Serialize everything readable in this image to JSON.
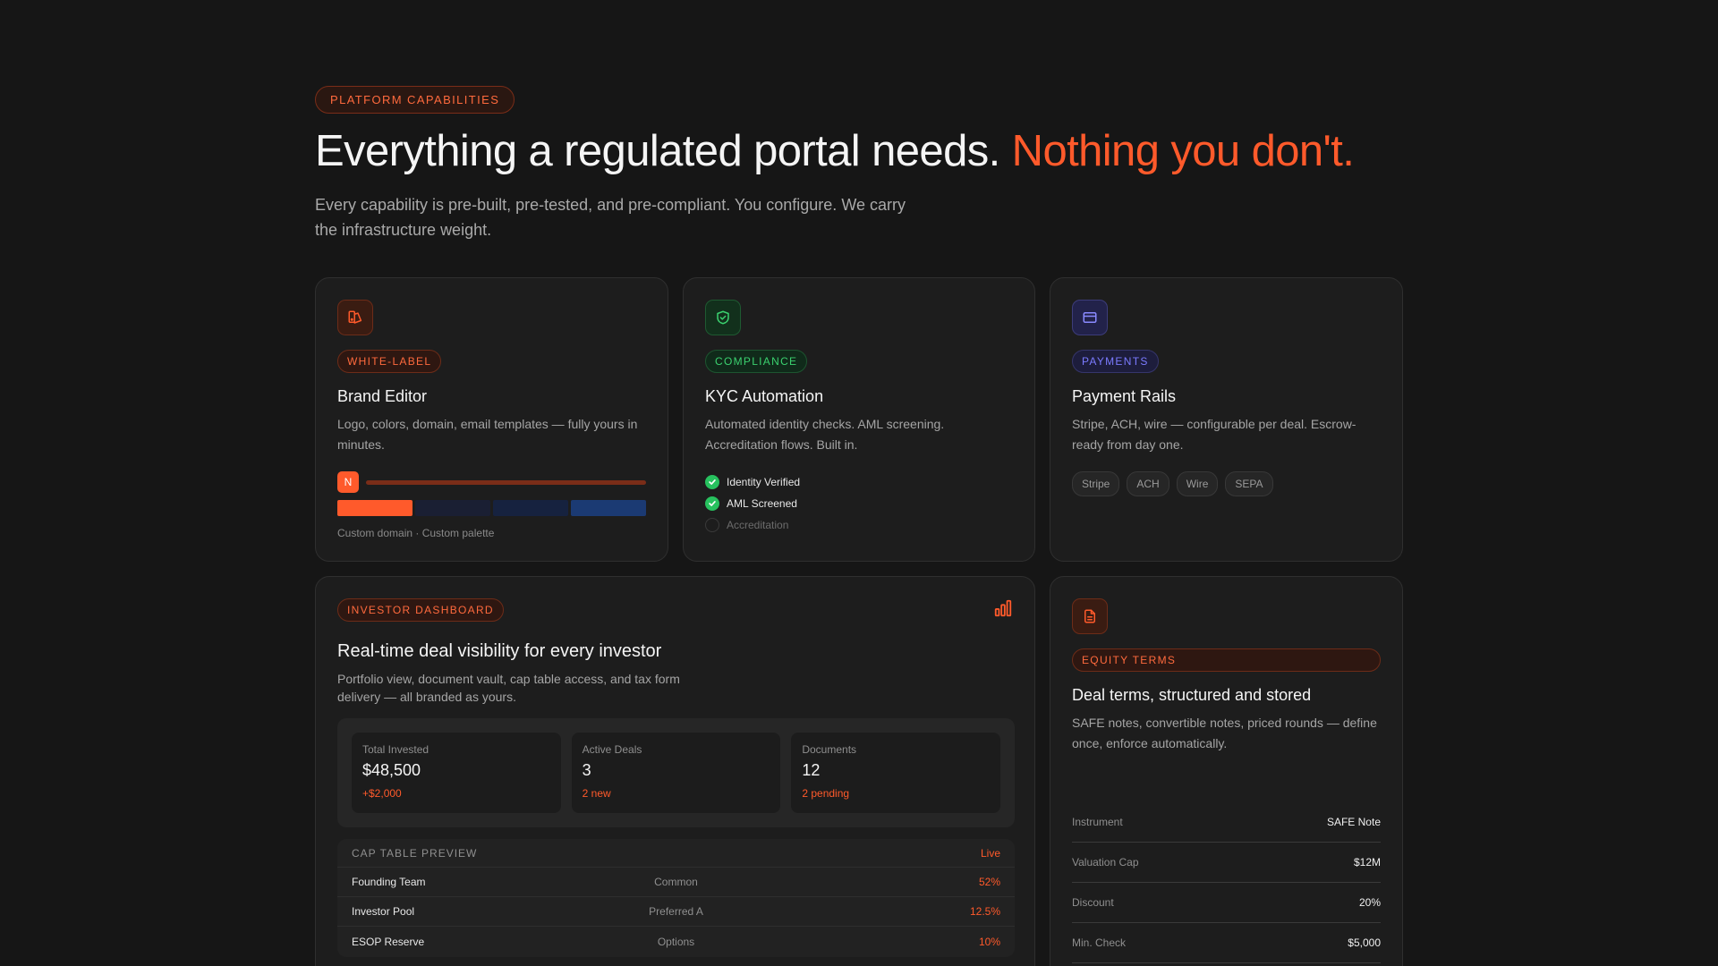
{
  "header": {
    "eyebrow": "PLATFORM CAPABILITIES",
    "headline_main": "Everything a regulated portal needs.",
    "headline_accent": "Nothing you don't.",
    "subhead": "Every capability is pre-built, pre-tested, and pre-compliant. You configure. We carry the infrastructure weight."
  },
  "colors": {
    "background": "#161616",
    "accent_orange": "#ff5a2b",
    "accent_green": "#27c15e",
    "accent_purple": "#7b7bff"
  },
  "cards": {
    "brand": {
      "icon": "brand-palette-icon",
      "tag": "WHITE-LABEL",
      "title": "Brand Editor",
      "desc": "Logo, colors, domain, email templates — fully yours in minutes.",
      "avatar_letter": "N",
      "swatches": [
        "#ff5a2b",
        "#1a1f33",
        "#16223f",
        "#1b3a73"
      ],
      "note": "Custom domain · Custom palette"
    },
    "kyc": {
      "icon": "shield-check-icon",
      "tag": "COMPLIANCE",
      "title": "KYC Automation",
      "desc": "Automated identity checks. AML screening. Accreditation flows. Built in.",
      "checks": [
        {
          "label": "Identity Verified",
          "done": true
        },
        {
          "label": "AML Screened",
          "done": true
        },
        {
          "label": "Accreditation",
          "done": false
        }
      ]
    },
    "payments": {
      "icon": "credit-card-icon",
      "tag": "PAYMENTS",
      "title": "Payment Rails",
      "desc": "Stripe, ACH, wire — configurable per deal. Escrow-ready from day one.",
      "rails": [
        "Stripe",
        "ACH",
        "Wire",
        "SEPA"
      ]
    },
    "dashboard": {
      "icon": "bar-chart-icon",
      "tag": "INVESTOR DASHBOARD",
      "title": "Real-time deal visibility for every investor",
      "desc": "Portfolio view, document vault, cap table access, and tax form delivery — all branded as yours.",
      "stats": [
        {
          "label": "Total Invested",
          "value": "$48,500",
          "sub": "+$2,000"
        },
        {
          "label": "Active Deals",
          "value": "3",
          "sub": "2 new"
        },
        {
          "label": "Documents",
          "value": "12",
          "sub": "2 pending"
        }
      ],
      "cap_table": {
        "title": "CAP TABLE PREVIEW",
        "status": "Live",
        "rows": [
          {
            "holder": "Founding Team",
            "class": "Common",
            "pct": "52%"
          },
          {
            "holder": "Investor Pool",
            "class": "Preferred A",
            "pct": "12.5%"
          },
          {
            "holder": "ESOP Reserve",
            "class": "Options",
            "pct": "10%"
          }
        ]
      }
    },
    "equity": {
      "icon": "document-icon",
      "tag": "EQUITY TERMS",
      "title": "Deal terms, structured and stored",
      "desc": "SAFE notes, convertible notes, priced rounds — define once, enforce automatically.",
      "terms": [
        {
          "key": "Instrument",
          "value": "SAFE Note"
        },
        {
          "key": "Valuation Cap",
          "value": "$12M"
        },
        {
          "key": "Discount",
          "value": "20%"
        },
        {
          "key": "Min. Check",
          "value": "$5,000"
        }
      ]
    }
  }
}
